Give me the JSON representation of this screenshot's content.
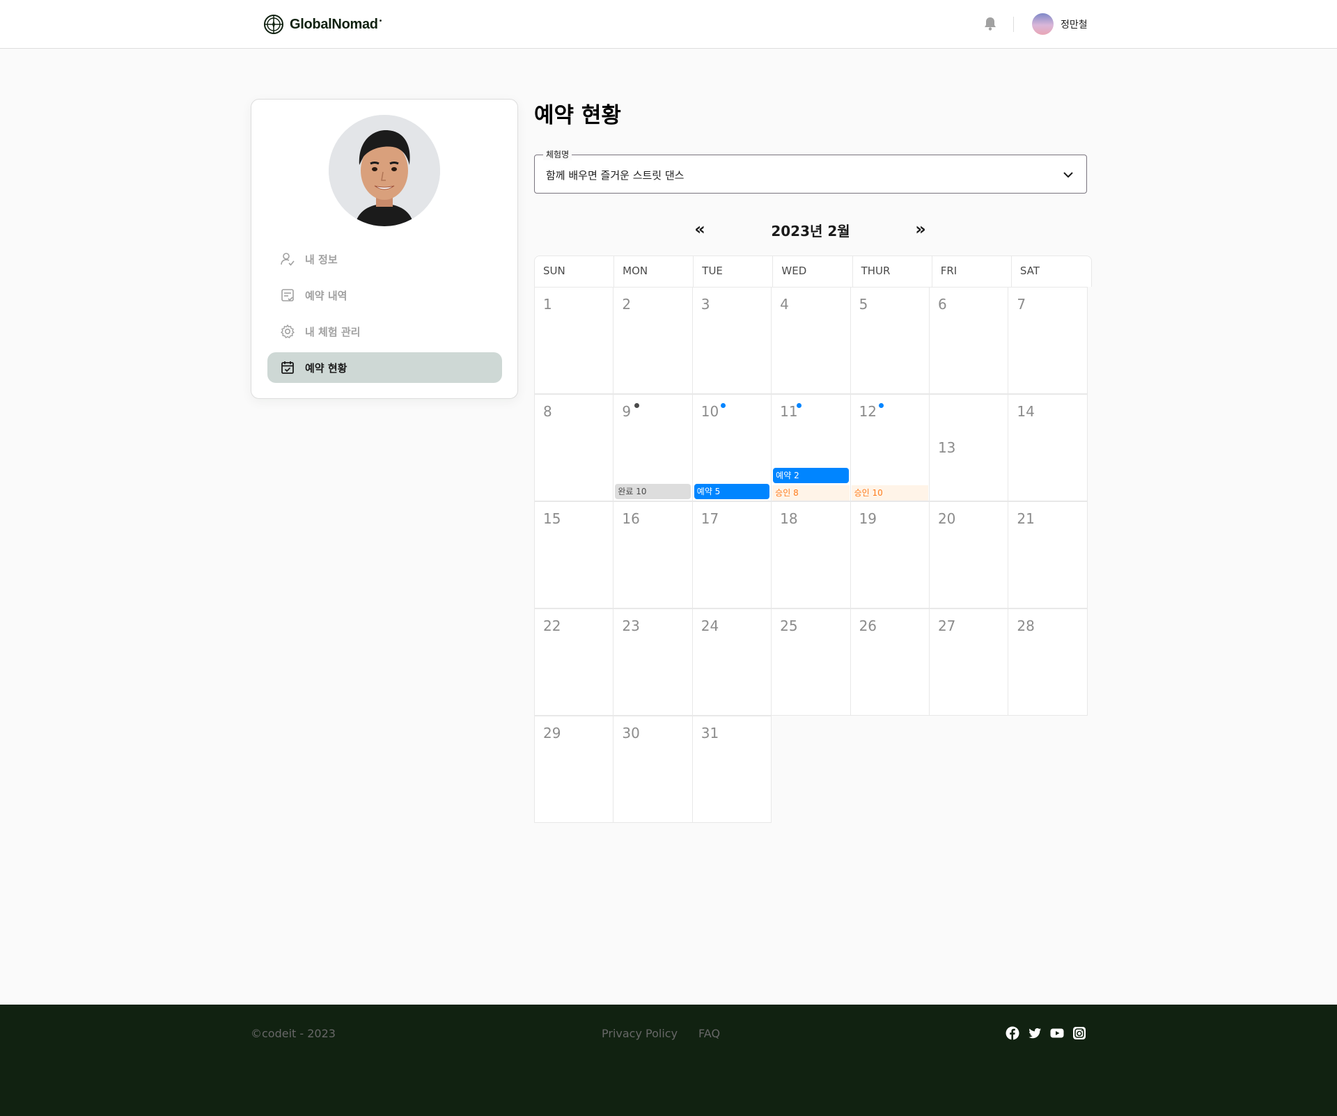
{
  "header": {
    "logo_text": "GlobalNomad",
    "user_name": "정만철"
  },
  "sidebar": {
    "items": [
      {
        "label": "내 정보",
        "icon": "user-check-icon",
        "active": false
      },
      {
        "label": "예약 내역",
        "icon": "list-check-icon",
        "active": false
      },
      {
        "label": "내 체험 관리",
        "icon": "gear-icon",
        "active": false
      },
      {
        "label": "예약 현황",
        "icon": "calendar-check-icon",
        "active": true
      }
    ]
  },
  "main": {
    "title": "예약 현황",
    "activity_select": {
      "label": "체험명",
      "value": "함께 배우면 즐거운 스트릿 댄스"
    },
    "calendar": {
      "month_title": "2023년 2월",
      "prev_label": "«",
      "next_label": "»",
      "weekdays": [
        "SUN",
        "MON",
        "TUE",
        "WED",
        "THUR",
        "FRI",
        "SAT"
      ],
      "days": [
        "1",
        "2",
        "3",
        "4",
        "5",
        "6",
        "7",
        "8",
        "9",
        "10",
        "11",
        "12",
        "13",
        "14",
        "15",
        "16",
        "17",
        "18",
        "19",
        "20",
        "21",
        "22",
        "23",
        "24",
        "25",
        "26",
        "27",
        "28",
        "29",
        "30",
        "31"
      ],
      "events": {
        "done_9": "완료 10",
        "reserve_10": "예약 5",
        "reserve_11": "예약 2",
        "approve_11": "승인 8",
        "approve_12": "승인 10"
      }
    }
  },
  "footer": {
    "copyright": "©codeit - 2023",
    "links": [
      "Privacy Policy",
      "FAQ"
    ],
    "social_icons": [
      "facebook-icon",
      "twitter-icon",
      "youtube-icon",
      "instagram-icon"
    ]
  },
  "colors": {
    "brand_dark": "#112211",
    "active_menu": "#CED8D5",
    "reserve_blue": "#0085FF",
    "approve_orange": "#FF7C1D",
    "done_gray": "#DDDDDD"
  }
}
